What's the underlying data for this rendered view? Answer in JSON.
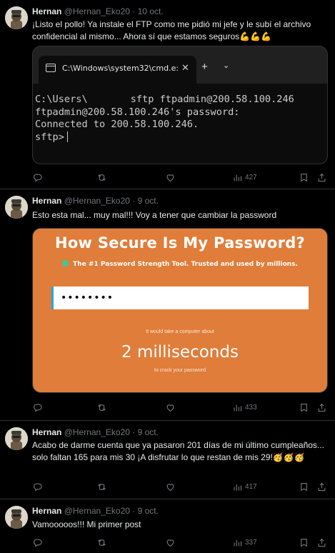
{
  "tweets": [
    {
      "name": "Hernan",
      "handle": "@Hernan_Eko20",
      "sep": "·",
      "date": "10 oct.",
      "text": "¡Listo el pollo! Ya instale el FTP como me pidió mi jefe y le subí el archivo confidencial al mismo... Ahora sí que estamos seguros💪💪💪",
      "views": "427"
    },
    {
      "name": "Hernan",
      "handle": "@Hernan_Eko20",
      "sep": "·",
      "date": "9 oct.",
      "text": "Esto esta mal... muy mal!!! Voy a tener que cambiar la password",
      "views": "433"
    },
    {
      "name": "Hernan",
      "handle": "@Hernan_Eko20",
      "sep": "·",
      "date": "9 oct.",
      "text": "Acabo de darme cuenta que ya pasaron 201 días de mi último cumpleaños... solo faltan 165 para mis 30 ¡A disfrutar lo que restan de mis 29!🥳🥳🥳",
      "views": "417"
    },
    {
      "name": "Hernan",
      "handle": "@Hernan_Eko20",
      "sep": "·",
      "date": "9 oct.",
      "text": "Vamooooos!!! Mi primer post",
      "views": "337"
    }
  ],
  "terminal": {
    "tab_title": "C:\\Windows\\system32\\cmd.e:",
    "close": "✕",
    "plus": "+",
    "chevron": "⌄",
    "line1_prefix": "C:\\Users\\",
    "line1_suffix": "sftp ftpadmin@200.58.100.246",
    "line2": "ftpadmin@200.58.100.246's password:",
    "line3": "Connected to 200.58.100.246.",
    "line4": "sftp>"
  },
  "password_card": {
    "title": "How Secure Is My Password?",
    "subtitle": "The #1 Password Strength Tool. Trusted and used by millions.",
    "input_value": "••••••••",
    "result_prefix": "It would take a computer about",
    "result_value": "2 milliseconds",
    "result_suffix": "to crack your password"
  },
  "icons": [
    "reply-icon",
    "retweet-icon",
    "like-icon",
    "views-icon",
    "bookmark-icon",
    "share-icon"
  ],
  "colors": {
    "background": "#000000",
    "muted": "#71767b",
    "card_orange": "#e07d3a",
    "accent_green": "#3cc89b"
  }
}
